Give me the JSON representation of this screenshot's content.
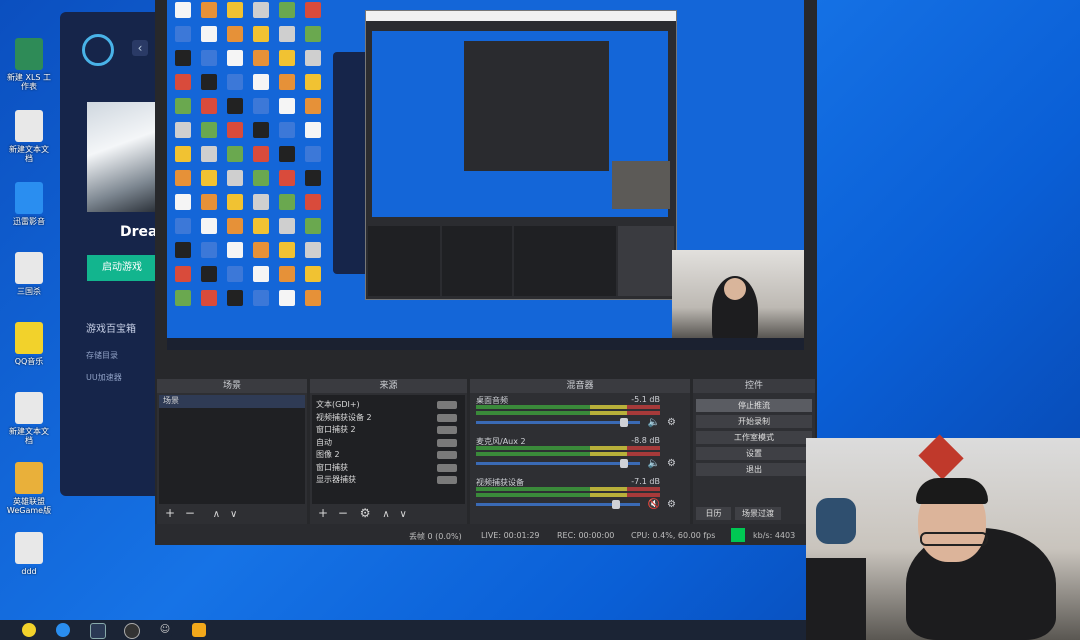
{
  "desktop": {
    "icons": [
      {
        "label": "新建 XLS 工作表",
        "color": "#2e8b57"
      },
      {
        "label": "新建文本文档",
        "color": "#e8e8e8"
      },
      {
        "label": "迅雷影音",
        "color": "#2a8ef0"
      },
      {
        "label": "三国杀",
        "color": "#e8e8e8"
      },
      {
        "label": "QQ音乐",
        "color": "#f2d22b"
      },
      {
        "label": "新建文本文档",
        "color": "#e8e8e8"
      },
      {
        "label": "英雄联盟WeGame版",
        "color": "#e9b03a"
      },
      {
        "label": "ddd",
        "color": "#e8e8e8"
      }
    ]
  },
  "launcher": {
    "title": "Drea",
    "start_button": "启动游戏",
    "toolbox": "游戏百宝箱",
    "links": [
      "存储目录",
      "UU加速器"
    ]
  },
  "obs": {
    "panels": {
      "scenes": {
        "header": "场景",
        "items": [
          "场景"
        ]
      },
      "sources": {
        "header": "来源",
        "items": [
          "文本(GDI+)",
          "视频捕获设备 2",
          "窗口捕获 2",
          "自动",
          "图像 2",
          "窗口捕获",
          "显示器捕获"
        ]
      },
      "mixer": {
        "header": "混音器",
        "channels": [
          {
            "name": "桌面音频",
            "db": "-5.1 dB",
            "muted": false
          },
          {
            "name": "麦克风/Aux 2",
            "db": "-8.8 dB",
            "muted": false
          },
          {
            "name": "视频捕获设备",
            "db": "-7.1 dB",
            "muted": true
          }
        ]
      },
      "controls": {
        "header": "控件",
        "buttons": [
          "停止推流",
          "开始录制",
          "工作室模式",
          "设置",
          "退出"
        ],
        "bottom_left": "日历",
        "bottom_right": "场景过渡"
      }
    },
    "panel_footer": [
      "+",
      "−",
      "∧",
      "∨"
    ],
    "status": {
      "dropped": "丢帧 0 (0.0%)",
      "live": "LIVE: 00:01:29",
      "rec": "REC: 00:00:00",
      "cpu": "CPU: 0.4%, 60.00 fps",
      "kbps": "kb/s: 4403"
    },
    "accent": "#00c853"
  },
  "taskbar": {
    "icons": [
      "start-icon",
      "edge-icon",
      "steam-icon",
      "obs-icon",
      "chat-icon",
      "game-icon"
    ]
  }
}
